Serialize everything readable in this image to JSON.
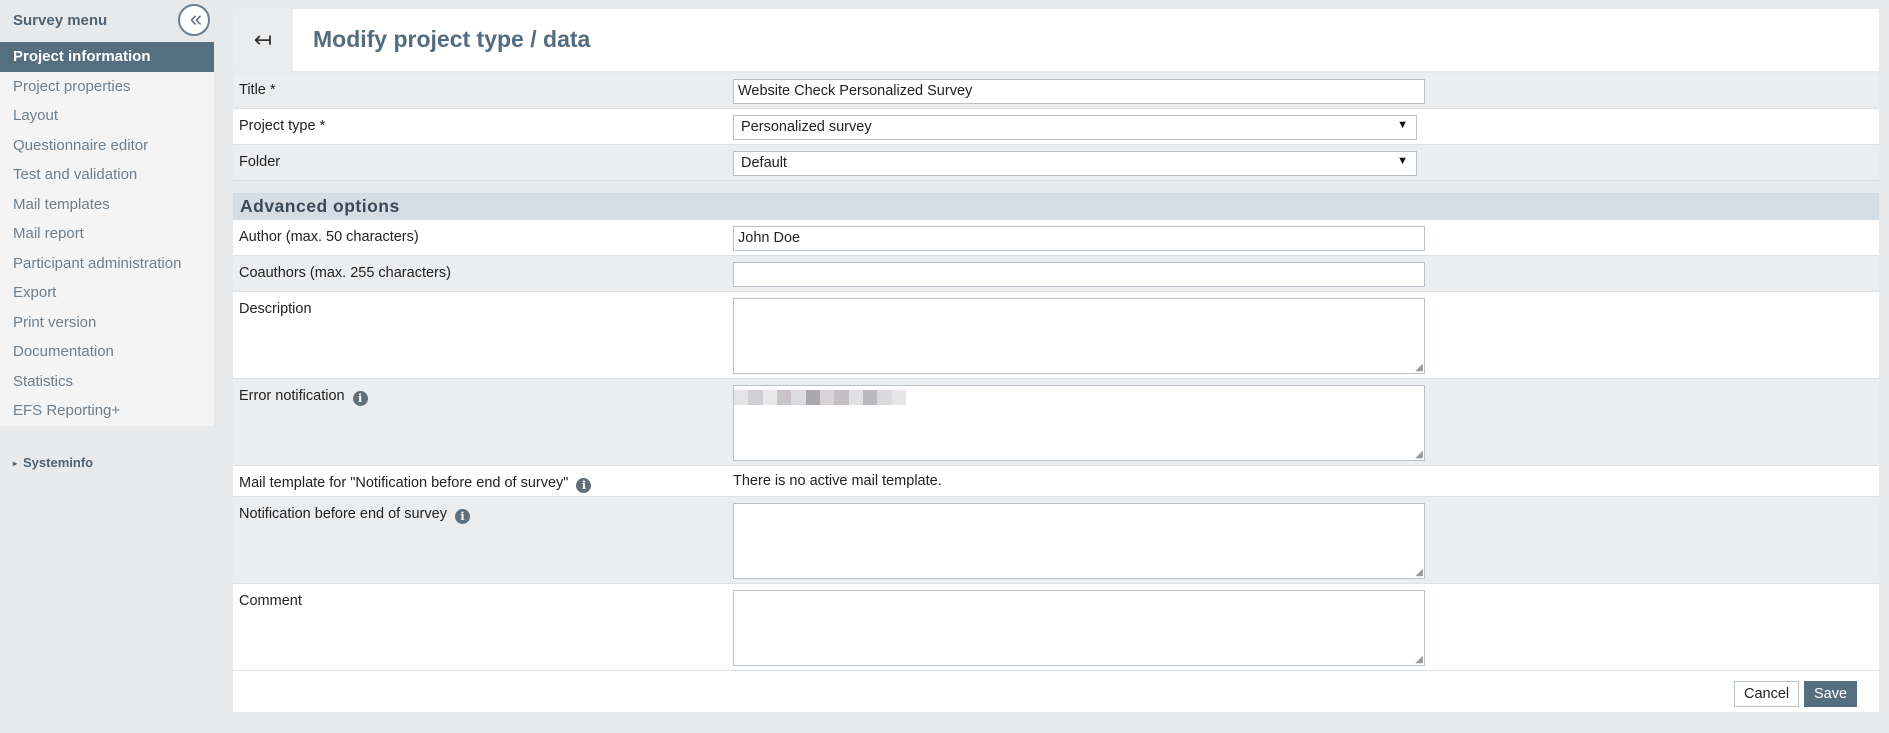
{
  "sidebar": {
    "title": "Survey menu",
    "collapse_glyph": "«",
    "items": [
      {
        "label": "Project information"
      },
      {
        "label": "Project properties"
      },
      {
        "label": "Layout"
      },
      {
        "label": "Questionnaire editor"
      },
      {
        "label": "Test and validation"
      },
      {
        "label": "Mail templates"
      },
      {
        "label": "Mail report"
      },
      {
        "label": "Participant administration"
      },
      {
        "label": "Export"
      },
      {
        "label": "Print version"
      },
      {
        "label": "Documentation"
      },
      {
        "label": "Statistics"
      },
      {
        "label": "EFS Reporting+"
      }
    ],
    "systeminfo_label": "Systeminfo"
  },
  "header": {
    "back_glyph": "↤",
    "title": "Modify project type / data"
  },
  "form": {
    "title": {
      "label": "Title *",
      "value": "Website Check Personalized Survey"
    },
    "project_type": {
      "label": "Project type *",
      "value": "Personalized survey"
    },
    "folder": {
      "label": "Folder",
      "value": "Default"
    },
    "advanced_heading": "Advanced options",
    "author": {
      "label": "Author (max. 50 characters)",
      "value": "John Doe"
    },
    "coauthors": {
      "label": "Coauthors (max. 255 characters)",
      "value": ""
    },
    "description": {
      "label": "Description",
      "value": ""
    },
    "error_notification": {
      "label": "Error notification"
    },
    "mail_template": {
      "label": "Mail template for \"Notification before end of survey\"",
      "value": "There is no active mail template."
    },
    "notification_end": {
      "label": "Notification before end of survey",
      "value": ""
    },
    "comment": {
      "label": "Comment",
      "value": ""
    }
  },
  "footer": {
    "cancel_label": "Cancel",
    "save_label": "Save"
  },
  "colors": {
    "accent": "#566f80",
    "title": "#536c7f",
    "section_bg": "#d4dde3",
    "row_shaded": "#ecedef"
  },
  "icons": {
    "collapse": "double-chevron-left-icon",
    "back": "back-arrow-icon",
    "info": "info-icon",
    "dropdown": "caret-down-icon"
  }
}
